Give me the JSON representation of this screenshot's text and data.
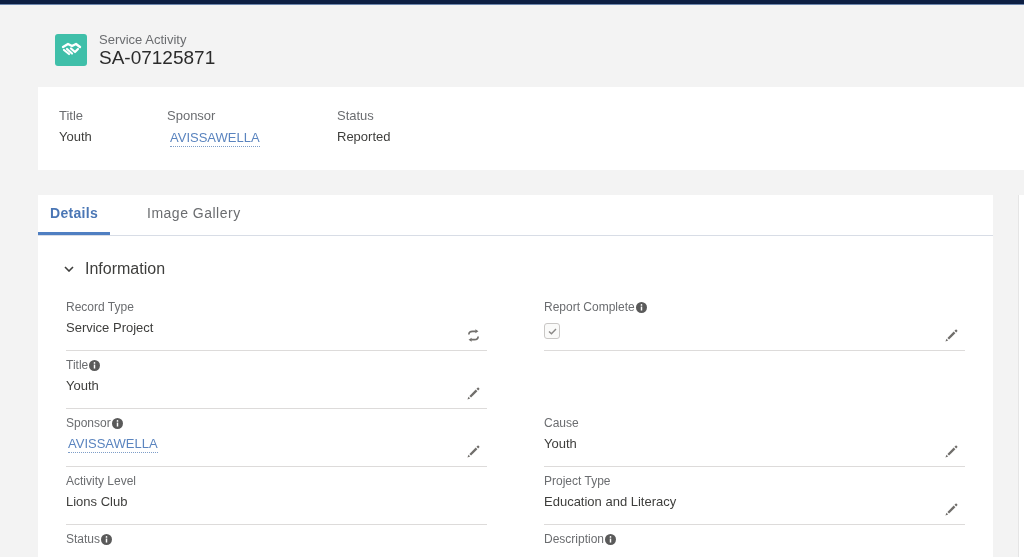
{
  "header": {
    "object_type": "Service Activity",
    "record_name": "SA-07125871"
  },
  "highlights": [
    {
      "label": "Title",
      "value": "Youth",
      "kind": "text"
    },
    {
      "label": "Sponsor",
      "value": "AVISSAWELLA",
      "kind": "link"
    },
    {
      "label": "Status",
      "value": "Reported",
      "kind": "text"
    }
  ],
  "tabs": [
    {
      "label": "Details",
      "selected": true
    },
    {
      "label": "Image Gallery",
      "selected": false
    }
  ],
  "section": {
    "title": "Information",
    "expanded": true
  },
  "field_columns": [
    {
      "fields": [
        {
          "kind": "text",
          "label": "Record Type",
          "info": false,
          "value": "Service Project",
          "editable": false,
          "type_switch": true
        },
        {
          "kind": "text",
          "label": "Title",
          "info": true,
          "value": "Youth",
          "editable": true,
          "type_switch": false
        },
        {
          "kind": "link",
          "label": "Sponsor",
          "info": true,
          "value": "AVISSAWELLA",
          "editable": true,
          "type_switch": false
        },
        {
          "kind": "text",
          "label": "Activity Level",
          "info": false,
          "value": "Lions Club",
          "editable": false,
          "type_switch": false
        },
        {
          "kind": "text",
          "label": "Status",
          "info": true,
          "editable": false,
          "type_switch": false
        }
      ]
    },
    {
      "fields": [
        {
          "kind": "checkbox",
          "label": "Report Complete",
          "info": true,
          "checked": true,
          "editable": true,
          "type_switch": false
        },
        {
          "kind": "blank"
        },
        {
          "kind": "text",
          "label": "Cause",
          "info": false,
          "value": "Youth",
          "editable": true,
          "type_switch": false
        },
        {
          "kind": "text",
          "label": "Project Type",
          "info": false,
          "value": "Education and Literacy",
          "editable": true,
          "type_switch": false
        },
        {
          "kind": "text",
          "label": "Description",
          "info": true,
          "editable": false,
          "type_switch": false
        }
      ]
    }
  ]
}
